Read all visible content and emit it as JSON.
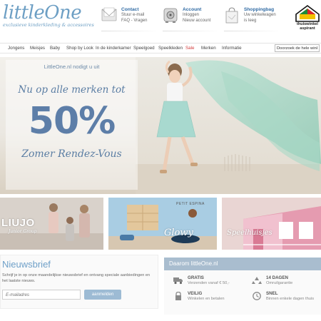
{
  "header": {
    "logo_main": "littleOne",
    "logo_tagline": "exclusieve kinderkleding & accessoires",
    "contact": {
      "title": "Contact",
      "line1": "Stuur e-mail",
      "line2": "FAQ - Vragen",
      "icon": "envelope-icon"
    },
    "account": {
      "title": "Account",
      "line1": "Inloggen",
      "line2": "Nieuw account",
      "icon": "safe-icon"
    },
    "shoppingbag": {
      "title": "Shoppingbag",
      "line1": "Uw winkelwagen",
      "line2": "is leeg",
      "icon": "shopping-bag-icon"
    },
    "badge": {
      "line1": "thuiswinkel",
      "line2": "aspirant"
    }
  },
  "nav": {
    "items": [
      "Jongens",
      "Meisjes",
      "Baby",
      "Shop by Look",
      "In de kinderkamer",
      "Speelgoed",
      "Speelkleden",
      "Sale",
      "Merken",
      "Informatie"
    ],
    "search_value": "Doorzoek de hele winkel"
  },
  "hero": {
    "intro": "LittleOne.nl nodigt u uit",
    "line1": "Nu op alle merken tot",
    "percent": "50%",
    "line2": "Zomer Rendez-Vous"
  },
  "tiles": [
    {
      "label": "LIUJO",
      "sublabel": "Junior Group"
    },
    {
      "label": "Glowy",
      "sign": "PETIT ESPINA"
    },
    {
      "label": "Speelhuisjes"
    }
  ],
  "newsletter": {
    "title": "Nieuwsbrief",
    "text": "Schrijf je in op onze maandelijkse nieuwsbrief en ontvang speciale aanbiedingen en het laatste nieuws.",
    "placeholder": "E-mailadres",
    "button": "aanmelden"
  },
  "usp": {
    "heading": "Daarom littleOne.nl",
    "items": [
      {
        "title": "GRATIS",
        "sub": "Verzenden vanaf € 50,-",
        "icon": "truck-icon"
      },
      {
        "title": "14 DAGEN",
        "sub": "Omruilgarantie",
        "icon": "recycle-icon"
      },
      {
        "title": "VEILIG",
        "sub": "Winkelen en betalen",
        "icon": "lock-icon"
      },
      {
        "title": "SNEL",
        "sub": "Binnen enkele dagen thuis",
        "icon": "clock-icon"
      }
    ]
  },
  "colors": {
    "brand_blue": "#6d9fc4",
    "link_blue": "#2f6aa3",
    "sale_red": "#d23b3b",
    "usp_header": "#a9bdcf",
    "button": "#9dbbd4"
  }
}
